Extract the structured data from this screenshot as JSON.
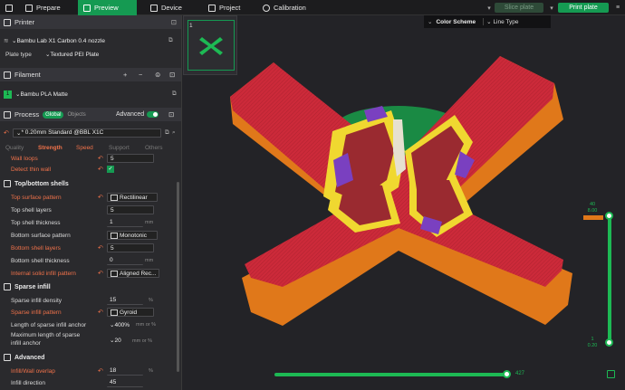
{
  "topbar": {
    "tabs": [
      {
        "label": "Prepare",
        "icon": "prepare-icon"
      },
      {
        "label": "Preview",
        "icon": "preview-icon"
      },
      {
        "label": "Device",
        "icon": "device-icon"
      },
      {
        "label": "Project",
        "icon": "project-icon"
      },
      {
        "label": "Calibration",
        "icon": "calibration-icon"
      }
    ],
    "slice_plate": "Slice plate",
    "print_plate": "Print plate"
  },
  "printer": {
    "section": "Printer",
    "name": "Bambu Lab X1 Carbon 0.4 nozzle",
    "plate_type_label": "Plate type",
    "plate_type": "Textured PEI Plate"
  },
  "filament": {
    "section": "Filament",
    "slot": "1",
    "name": "Bambu PLA Matte",
    "color": "#1db954"
  },
  "process": {
    "section": "Process",
    "global": "Global",
    "objects": "Objects",
    "advanced": "Advanced",
    "preset": "* 0.20mm Standard @BBL X1C",
    "tabs": [
      "Quality",
      "Strength",
      "Speed",
      "Support",
      "Others"
    ],
    "active_tab": "Strength"
  },
  "settings": {
    "wall_loops": {
      "label": "Wall loops",
      "value": "5"
    },
    "detect_thin_wall": {
      "label": "Detect thin wall",
      "checked": true
    },
    "top_bottom_group": "Top/bottom shells",
    "top_surface_pattern": {
      "label": "Top surface pattern",
      "value": "Rectilinear"
    },
    "top_shell_layers": {
      "label": "Top shell layers",
      "value": "5"
    },
    "top_shell_thickness": {
      "label": "Top shell thickness",
      "value": "1",
      "unit": "mm"
    },
    "bottom_surface_pattern": {
      "label": "Bottom surface pattern",
      "value": "Monotonic"
    },
    "bottom_shell_layers": {
      "label": "Bottom shell layers",
      "value": "5"
    },
    "bottom_shell_thickness": {
      "label": "Bottom shell thickness",
      "value": "0",
      "unit": "mm"
    },
    "internal_solid_infill_pattern": {
      "label": "Internal solid infill pattern",
      "value": "Aligned Rec..."
    },
    "sparse_group": "Sparse infill",
    "sparse_infill_density": {
      "label": "Sparse infill density",
      "value": "15",
      "unit": "%"
    },
    "sparse_infill_pattern": {
      "label": "Sparse infill pattern",
      "value": "Gyroid"
    },
    "length_anchor": {
      "label": "Length of sparse infill anchor",
      "value": "400%",
      "unit": "mm or %"
    },
    "max_length_anchor": {
      "label1": "Maximum length of sparse",
      "label2": "infill anchor",
      "value": "20",
      "unit": "mm or %"
    },
    "advanced_group": "Advanced",
    "infill_wall_overlap": {
      "label": "Infill/Wall overlap",
      "value": "18",
      "unit": "%"
    },
    "infill_direction": {
      "label": "Infill direction",
      "value": "45"
    }
  },
  "viewport": {
    "thumbnail_index": "1",
    "color_scheme_label": "Color Scheme",
    "color_scheme_value": "Line Type",
    "layer_top": "40",
    "layer_top_height": "8.00",
    "layer_bottom": "1",
    "layer_bottom_height": "0.20",
    "move_value": "427"
  },
  "colors": {
    "accent": "#159a52",
    "wall": "#e0781a",
    "top_surface": "#cc2a3a",
    "inner_wall": "#f0d830",
    "infill": "#9a2a30",
    "bed": "#1a8a44"
  }
}
